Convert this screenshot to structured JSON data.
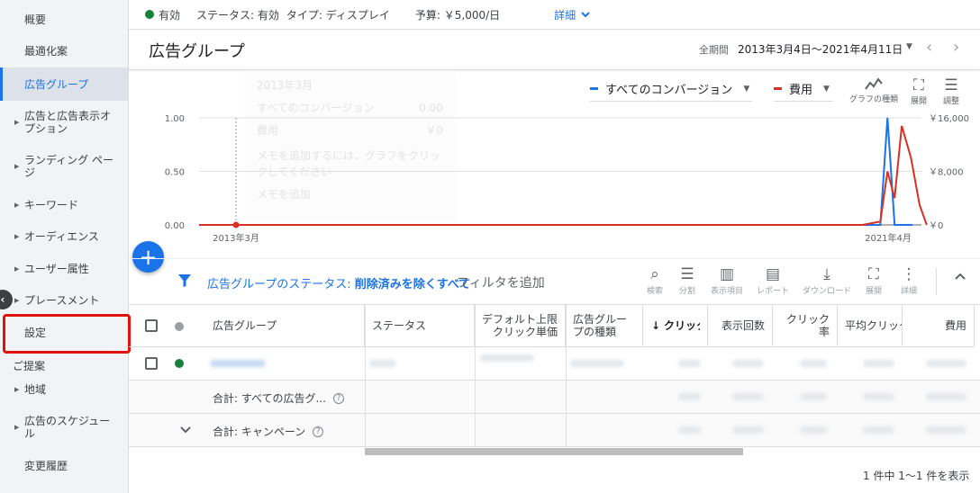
{
  "sidebar": {
    "items": [
      {
        "label": "概要",
        "expandable": false
      },
      {
        "label": "最適化案",
        "expandable": false
      },
      {
        "label": "広告グループ",
        "expandable": false,
        "active": true
      },
      {
        "label": "広告と広告表示オプション",
        "expandable": true
      },
      {
        "label": "ランディング ページ",
        "expandable": true
      },
      {
        "label": "キーワード",
        "expandable": true
      },
      {
        "label": "オーディエンス",
        "expandable": true
      },
      {
        "label": "ユーザー属性",
        "expandable": true
      },
      {
        "label": "プレースメント",
        "expandable": true
      },
      {
        "label": "設定",
        "expandable": false,
        "highlighted": true
      },
      {
        "label": "地域",
        "expandable": true
      },
      {
        "label": "広告のスケジュール",
        "expandable": true
      },
      {
        "label": "変更履歴",
        "expandable": false
      }
    ],
    "section_label": "ご提案",
    "highlight_color": "#e0120c"
  },
  "status_bar": {
    "status": "有効",
    "status_text": "ステータス: 有効",
    "type_text": "タイプ: ディスプレイ",
    "budget_text": "予算: ￥5,000/日",
    "details_link": "詳細",
    "status_color": "#188038"
  },
  "header": {
    "title": "広告グループ",
    "date_label": "全期間",
    "date_range": "2013年3月4日～2021年4月11日"
  },
  "chart_toolbar": {
    "metric1": "すべてのコンバージョン",
    "metric2": "費用",
    "chart_type": "グラフの種類",
    "expand": "展開",
    "adjust": "調整"
  },
  "ghost_panel": {
    "line1": "2013年3月",
    "line2": "すべてのコンバージョン",
    "line2_val": "0.00",
    "line3": "費用",
    "line3_val": "￥0",
    "line4": "メモを追加するには、グラフをクリックしてください",
    "line5": "メモを追加"
  },
  "chart_data": {
    "type": "line",
    "x_labels": [
      "2013年3月",
      "2021年4月"
    ],
    "left_ticks": [
      "1.00",
      "0.50",
      "0.00"
    ],
    "right_ticks": [
      "￥16,000",
      "￥8,000",
      "￥0"
    ],
    "ylim_left": [
      0,
      1
    ],
    "ylim_right": [
      0,
      16000
    ],
    "series": [
      {
        "name": "すべてのコンバージョン",
        "color": "#1a73e8",
        "points": [
          [
            0,
            0
          ],
          [
            0.93,
            0
          ],
          [
            0.955,
            0
          ],
          [
            0.965,
            1
          ],
          [
            0.975,
            0
          ],
          [
            1,
            0
          ]
        ]
      },
      {
        "name": "費用",
        "color": "#d93025",
        "points": [
          [
            0,
            0
          ],
          [
            0.93,
            0
          ],
          [
            0.955,
            500
          ],
          [
            0.965,
            8000
          ],
          [
            0.975,
            4000
          ],
          [
            0.985,
            14800
          ],
          [
            0.998,
            10000
          ],
          [
            1.01,
            3000
          ],
          [
            1.02,
            0
          ]
        ]
      }
    ]
  },
  "filter_bar": {
    "filter_prefix": "広告グループのステータス: ",
    "filter_value": "削除済みを除くすべて",
    "add_filter": "フィルタを追加",
    "tools": [
      "検索",
      "分割",
      "表示項目",
      "レポート",
      "ダウンロード",
      "展開",
      "詳細"
    ]
  },
  "table": {
    "headers": [
      "広告グループ",
      "ステータス",
      "デフォルト上限クリック単価",
      "広告グループの種類",
      "クリック数",
      "表示回数",
      "クリック率",
      "平均クリック単価",
      "費用"
    ],
    "total_ad_groups": "合計: すべての広告グ...",
    "total_campaign": "合計: キャンペーン",
    "pagination": "1 件中 1～1 件を表示"
  }
}
